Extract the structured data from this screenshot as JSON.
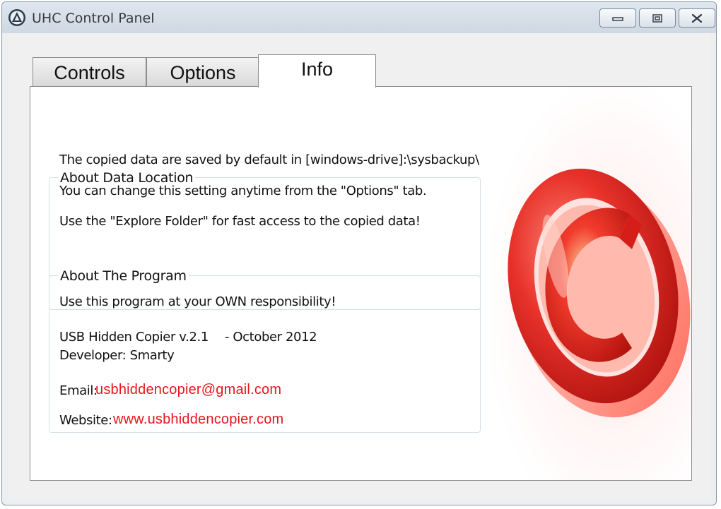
{
  "window": {
    "title": "UHC Control Panel"
  },
  "tabs": [
    {
      "label": "Controls",
      "active": false
    },
    {
      "label": "Options",
      "active": false
    },
    {
      "label": "Info",
      "active": true
    }
  ],
  "data_location": {
    "legend": "About Data Location",
    "line1": "The copied data are saved by default in [windows-drive]:\\sysbackup\\",
    "line2": "You can change this setting anytime from the \"Options\" tab.",
    "line3": "Use the \"Explore Folder\" for fast access to the copied data!"
  },
  "about_program": {
    "legend": "About The Program",
    "disclaimer": "Use this program at your OWN responsibility!",
    "version": "USB Hidden Copier v.2.1",
    "date": "- October 2012",
    "developer": "Developer: Smarty",
    "email_label": "Email:",
    "email": "usbhiddencopier@gmail.com",
    "website_label": "Website:",
    "website": "www.usbhiddencopier.com"
  },
  "colors": {
    "link": "#e8141b",
    "logo_red": "#e83a30"
  },
  "icons": {
    "app": "app-logo-icon",
    "logo": "copyright-c-logo"
  }
}
